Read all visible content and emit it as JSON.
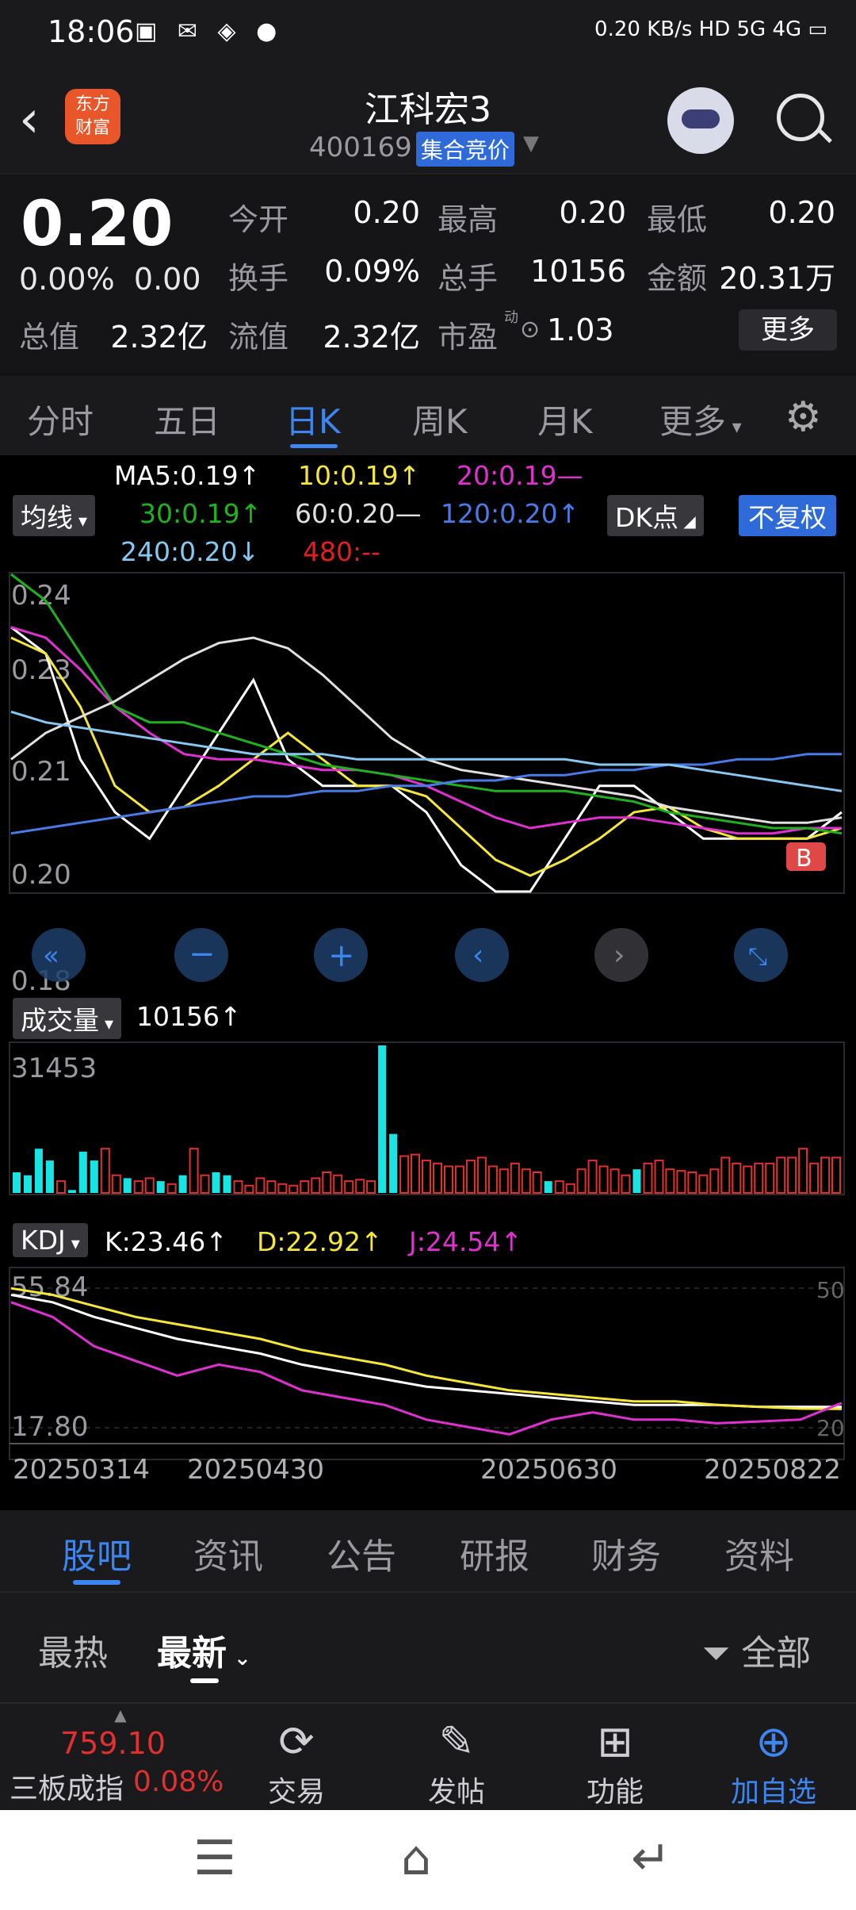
{
  "status": {
    "time": "18:06",
    "speed": "0.20 KB/s",
    "signal": "HD 5G 4G"
  },
  "header": {
    "title": "江科宏3",
    "code": "400169",
    "badge": "集合竞价",
    "logo_line1": "东方",
    "logo_line2": "财富"
  },
  "quote": {
    "price": "0.20",
    "change_pct": "0.00%",
    "change_abs": "0.00",
    "stats": [
      {
        "label": "今开",
        "value": "0.20"
      },
      {
        "label": "最高",
        "value": "0.20"
      },
      {
        "label": "最低",
        "value": "0.20"
      },
      {
        "label": "换手",
        "value": "0.09%"
      },
      {
        "label": "总手",
        "value": "10156"
      },
      {
        "label": "金额",
        "value": "20.31万"
      },
      {
        "label": "总值",
        "value": "2.32亿"
      },
      {
        "label": "流值",
        "value": "2.32亿"
      },
      {
        "label": "市盈",
        "value": "1.03"
      }
    ],
    "pe_mark": "动",
    "more": "更多"
  },
  "ktabs": [
    "分时",
    "五日",
    "日K",
    "周K",
    "月K",
    "更多"
  ],
  "indicators": {
    "ma_selector": "均线",
    "ma5": "MA5:0.19",
    "ma10": "10:0.19",
    "ma20": "20:0.19—",
    "ma30": "30:0.19",
    "ma60": "60:0.20—",
    "ma120": "120:0.20",
    "ma240": "240:0.20",
    "ma480": "480:--",
    "dk": "DK点",
    "fq": "不复权"
  },
  "colors": {
    "ma5": "#ffffff",
    "ma10": "#f5e63a",
    "ma20": "#e030d0",
    "ma30": "#1fb21f",
    "ma60": "#e0e0e0",
    "ma120": "#4a7ae8",
    "ma240": "#88c8f0",
    "ma480": "#e02020",
    "down": "#19e3e3",
    "up": "#e03030",
    "accent": "#3d86f0"
  },
  "volume": {
    "selector": "成交量",
    "value": "10156",
    "max_label": "31453"
  },
  "kdj": {
    "selector": "KDJ",
    "k": "K:23.46",
    "d": "D:22.92",
    "j": "J:24.54",
    "top": "55.84",
    "bottom": "17.80",
    "right_top": "50",
    "right_bottom": "20"
  },
  "chart_data": {
    "type": "line",
    "title": "",
    "dates": [
      "20250314",
      "20250430",
      "20250630",
      "20250822"
    ],
    "y_ticks": [
      "0.24",
      "0.23",
      "0.21",
      "0.20",
      "0.18"
    ],
    "ylim": [
      0.18,
      0.24
    ],
    "marker": "B",
    "series": [
      {
        "name": "MA5",
        "values": [
          0.23,
          0.225,
          0.205,
          0.195,
          0.19,
          0.2,
          0.21,
          0.22,
          0.205,
          0.2,
          0.2,
          0.2,
          0.195,
          0.185,
          0.18,
          0.18,
          0.19,
          0.2,
          0.2,
          0.195,
          0.19,
          0.19,
          0.19,
          0.19,
          0.195
        ]
      },
      {
        "name": "MA10",
        "values": [
          0.228,
          0.225,
          0.215,
          0.2,
          0.195,
          0.196,
          0.2,
          0.205,
          0.21,
          0.205,
          0.2,
          0.2,
          0.198,
          0.192,
          0.186,
          0.183,
          0.186,
          0.19,
          0.195,
          0.196,
          0.192,
          0.19,
          0.19,
          0.19,
          0.192
        ]
      },
      {
        "name": "MA20",
        "values": [
          0.23,
          0.228,
          0.222,
          0.215,
          0.21,
          0.206,
          0.205,
          0.205,
          0.204,
          0.203,
          0.203,
          0.202,
          0.2,
          0.197,
          0.194,
          0.192,
          0.193,
          0.194,
          0.194,
          0.193,
          0.192,
          0.191,
          0.191,
          0.192,
          0.192
        ]
      },
      {
        "name": "MA30",
        "values": [
          0.24,
          0.235,
          0.225,
          0.215,
          0.212,
          0.212,
          0.21,
          0.208,
          0.206,
          0.204,
          0.203,
          0.202,
          0.201,
          0.2,
          0.199,
          0.199,
          0.199,
          0.198,
          0.197,
          0.195,
          0.194,
          0.193,
          0.192,
          0.192,
          0.191
        ]
      },
      {
        "name": "MA60",
        "values": [
          0.205,
          0.21,
          0.213,
          0.216,
          0.22,
          0.224,
          0.227,
          0.228,
          0.226,
          0.221,
          0.215,
          0.209,
          0.205,
          0.203,
          0.202,
          0.201,
          0.2,
          0.199,
          0.198,
          0.196,
          0.195,
          0.194,
          0.193,
          0.193,
          0.194
        ]
      },
      {
        "name": "MA120",
        "values": [
          0.191,
          0.192,
          0.193,
          0.194,
          0.195,
          0.196,
          0.197,
          0.198,
          0.198,
          0.199,
          0.199,
          0.2,
          0.2,
          0.201,
          0.201,
          0.202,
          0.202,
          0.203,
          0.203,
          0.204,
          0.204,
          0.205,
          0.205,
          0.206,
          0.206
        ]
      },
      {
        "name": "MA240",
        "values": [
          0.214,
          0.212,
          0.211,
          0.21,
          0.209,
          0.208,
          0.207,
          0.206,
          0.206,
          0.206,
          0.205,
          0.205,
          0.205,
          0.205,
          0.205,
          0.205,
          0.205,
          0.204,
          0.204,
          0.204,
          0.203,
          0.202,
          0.201,
          0.2,
          0.199
        ]
      }
    ],
    "volume": [
      14,
      12,
      30,
      22,
      8,
      2,
      28,
      22,
      30,
      12,
      10,
      8,
      10,
      8,
      6,
      12,
      30,
      12,
      14,
      12,
      8,
      5,
      10,
      8,
      6,
      5,
      8,
      10,
      14,
      12,
      8,
      9,
      8,
      100,
      40,
      25,
      26,
      22,
      20,
      18,
      18,
      22,
      24,
      18,
      16,
      20,
      16,
      14,
      8,
      8,
      6,
      16,
      22,
      18,
      16,
      12,
      16,
      20,
      22,
      16,
      15,
      14,
      12,
      16,
      24,
      20,
      18,
      20,
      20,
      24,
      24,
      30,
      20,
      24,
      24
    ],
    "volume_down": [
      0,
      1,
      2,
      3,
      5,
      6,
      7,
      10,
      13,
      15,
      18,
      19,
      33,
      34,
      48,
      56
    ],
    "kdj": [
      {
        "name": "K",
        "values": [
          54,
          52,
          48,
          45,
          42,
          40,
          38,
          35,
          33,
          31,
          29,
          28,
          27,
          26,
          25,
          24,
          24,
          24,
          23.5,
          23.5,
          23.46
        ]
      },
      {
        "name": "D",
        "values": [
          55.8,
          54,
          51,
          48,
          46,
          44,
          42,
          39,
          37,
          35,
          32,
          30,
          28,
          27,
          26,
          25,
          25,
          24,
          23.5,
          23,
          22.92
        ]
      },
      {
        "name": "J",
        "values": [
          52,
          48,
          40,
          36,
          32,
          35,
          33,
          28,
          26,
          24,
          20,
          18,
          16,
          20,
          22,
          20,
          20,
          19,
          19.5,
          20,
          24.54
        ]
      }
    ]
  },
  "content_tabs": [
    "股吧",
    "资讯",
    "公告",
    "研报",
    "财务",
    "资料"
  ],
  "sort": {
    "hot": "最热",
    "latest": "最新",
    "filter": "全部"
  },
  "bottom_nav": {
    "index_value": "759.10",
    "index_name": "三板成指",
    "index_change": "0.08%",
    "trade": "交易",
    "post": "发帖",
    "func": "功能",
    "add": "加自选"
  }
}
